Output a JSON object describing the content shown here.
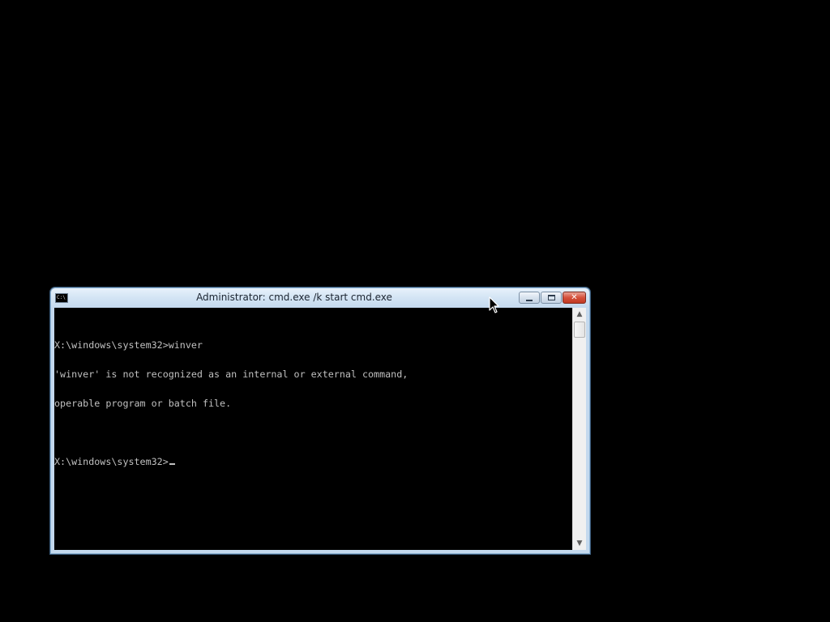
{
  "window": {
    "title": "Administrator: cmd.exe /k start cmd.exe",
    "icon": "console-app-icon",
    "icon_text": "C:\\",
    "controls": {
      "minimize_icon": "minimize-icon",
      "maximize_icon": "maximize-icon",
      "close_icon": "close-icon",
      "close_glyph": "✕"
    }
  },
  "console": {
    "lines": [
      "X:\\windows\\system32>winver",
      "'winver' is not recognized as an internal or external command,",
      "operable program or batch file.",
      "",
      "X:\\windows\\system32>"
    ],
    "text_color": "#c0c0c0",
    "background_color": "#000000"
  },
  "scrollbar": {
    "up_glyph": "▲",
    "down_glyph": "▼",
    "position": 0
  },
  "desktop": {
    "background_color": "#000000"
  }
}
